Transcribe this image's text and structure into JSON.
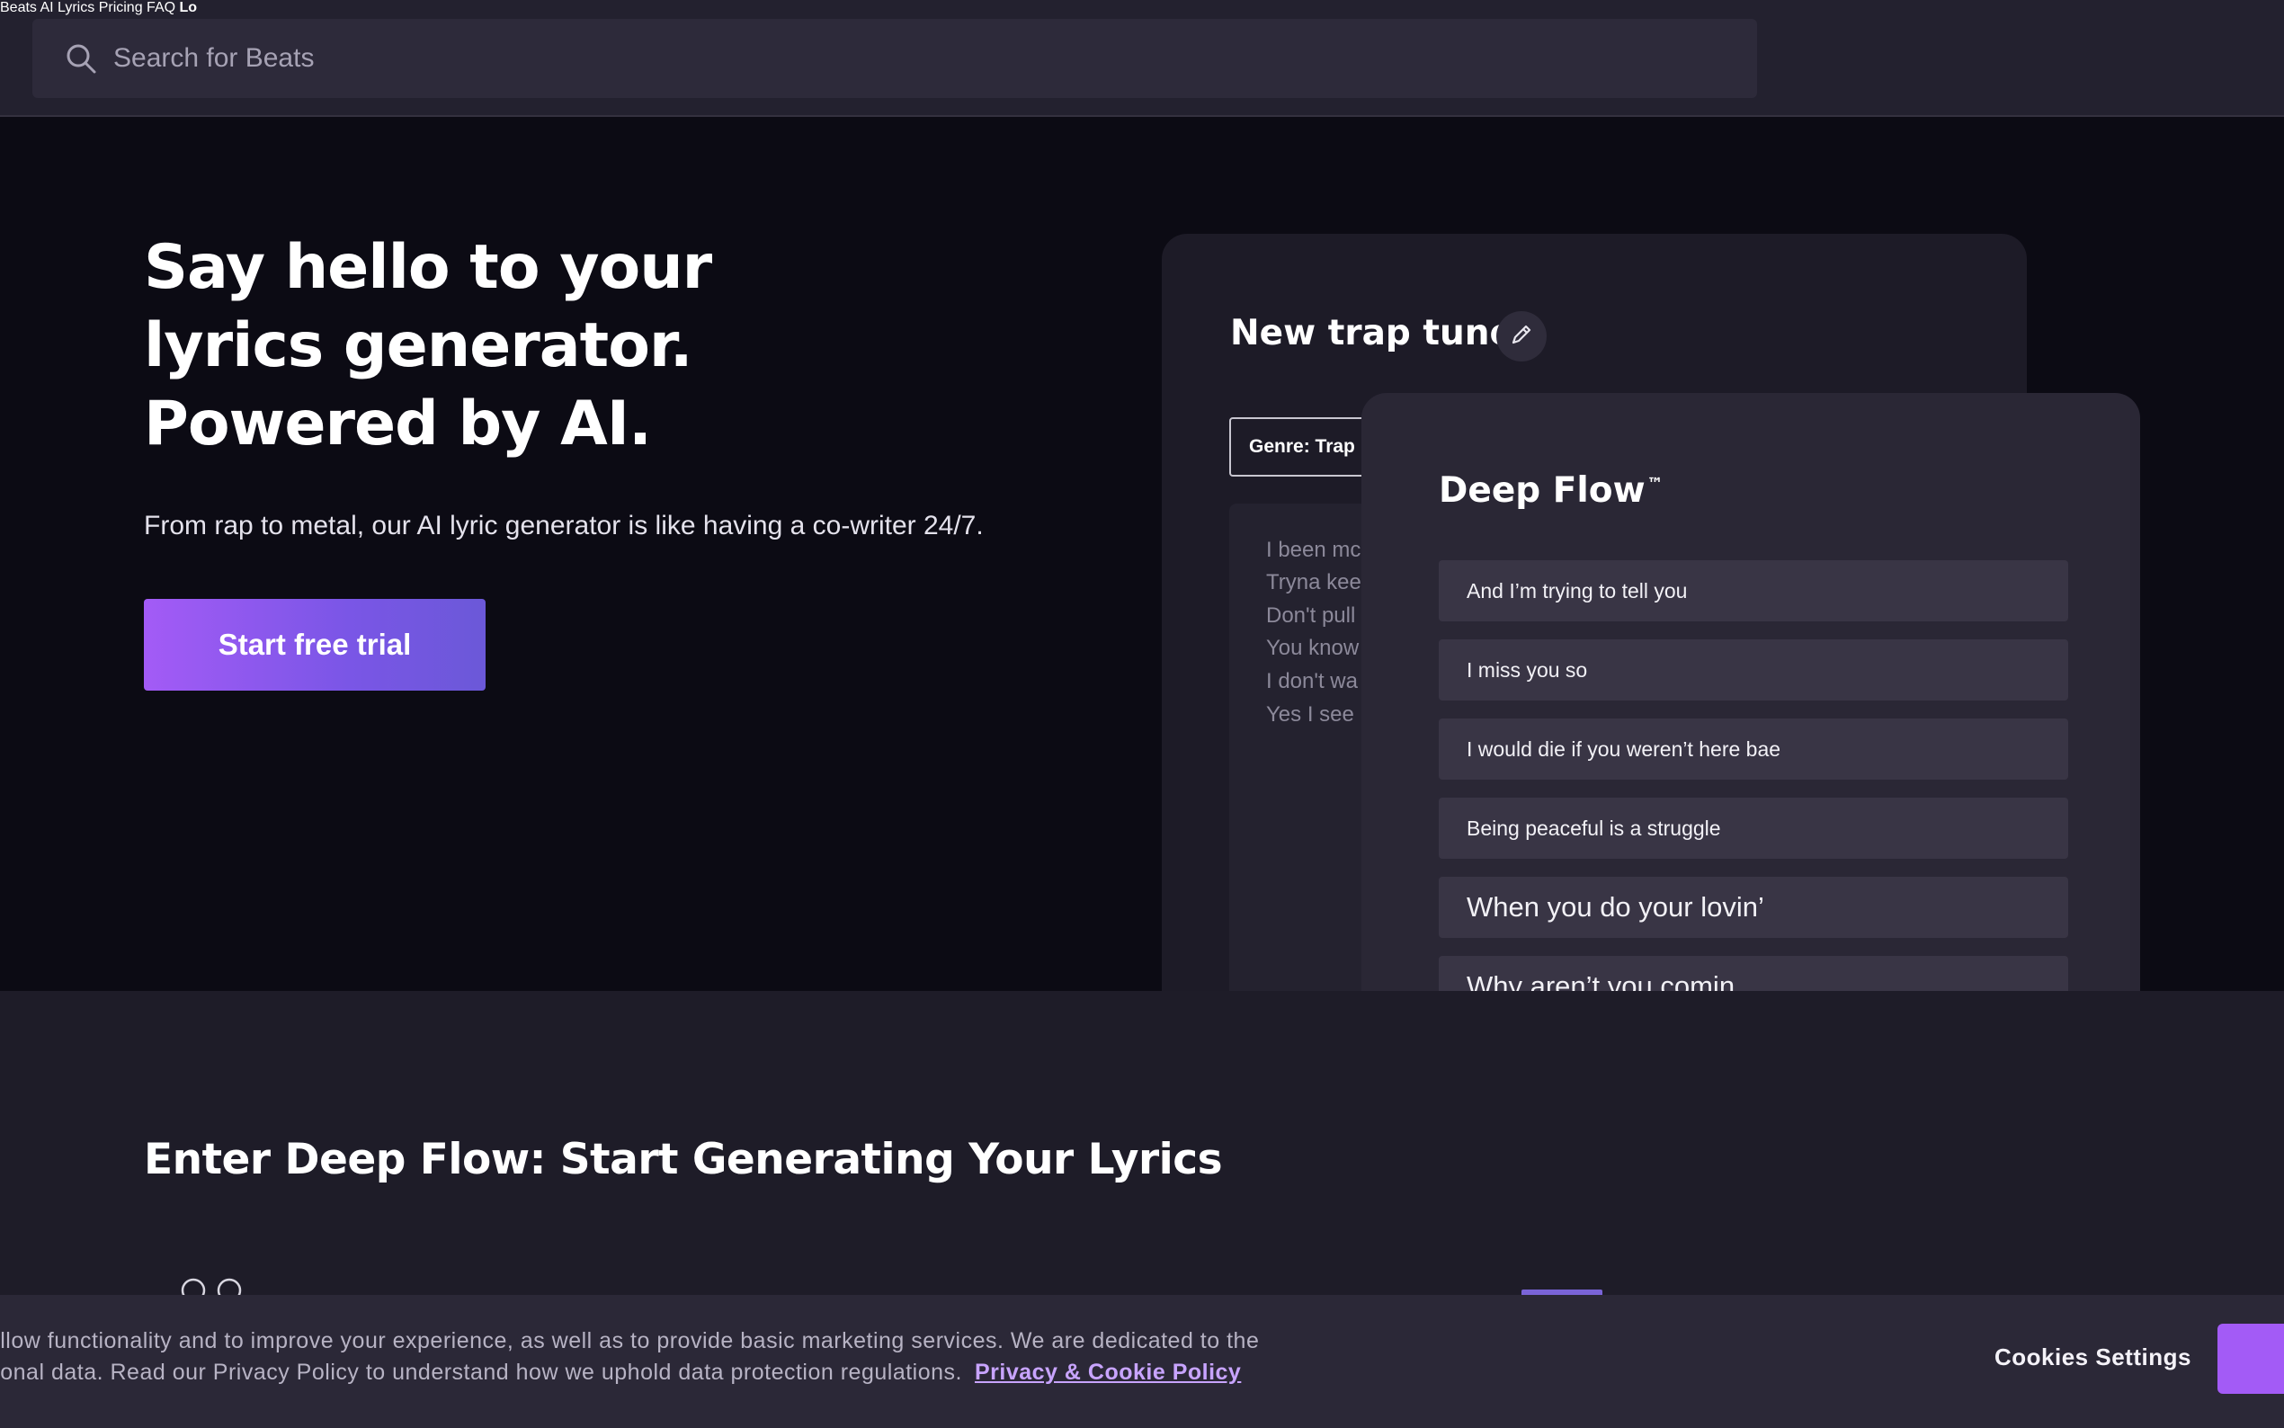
{
  "search": {
    "placeholder": "Search for Beats"
  },
  "nav": {
    "links": [
      "Beats",
      "AI Lyrics",
      "Pricing",
      "FAQ",
      "Lo"
    ]
  },
  "hero": {
    "headline": [
      "Say hello to your",
      "lyrics generator.",
      "Powered by AI."
    ],
    "subtitle": "From rap to metal, our AI lyric generator is like having a co-writer 24/7.",
    "cta_label": "Start free trial"
  },
  "editor": {
    "title": "New trap tune",
    "genre": "Genre: Trap",
    "lines": [
      "I been mc",
      "Tryna kee",
      "Don't pull",
      "You know",
      "I don't wa",
      "Yes I see"
    ]
  },
  "deep_flow": {
    "title": "Deep Flow",
    "trademark": "™",
    "suggestions": [
      "And I’m trying to tell you",
      "I miss you so",
      "I would die if you weren’t here bae",
      "Being peaceful is a struggle",
      "When you do your lovin’",
      "Why aren’t you comin"
    ]
  },
  "section2": {
    "heading": "Enter Deep Flow: Start Generating Your Lyrics"
  },
  "cookie": {
    "line1": "o allow functionality and to improve your experience, as well as to provide basic marketing services. We are dedicated to the",
    "line2": "ersonal data. Read our Privacy Policy to understand how we uphold data protection regulations.",
    "policy_link": "Privacy & Cookie Policy",
    "settings_label": "Cookies Settings"
  },
  "colors": {
    "accent": "#a35bf6",
    "background": "#0c0b14",
    "nav_bg": "#23212f"
  }
}
